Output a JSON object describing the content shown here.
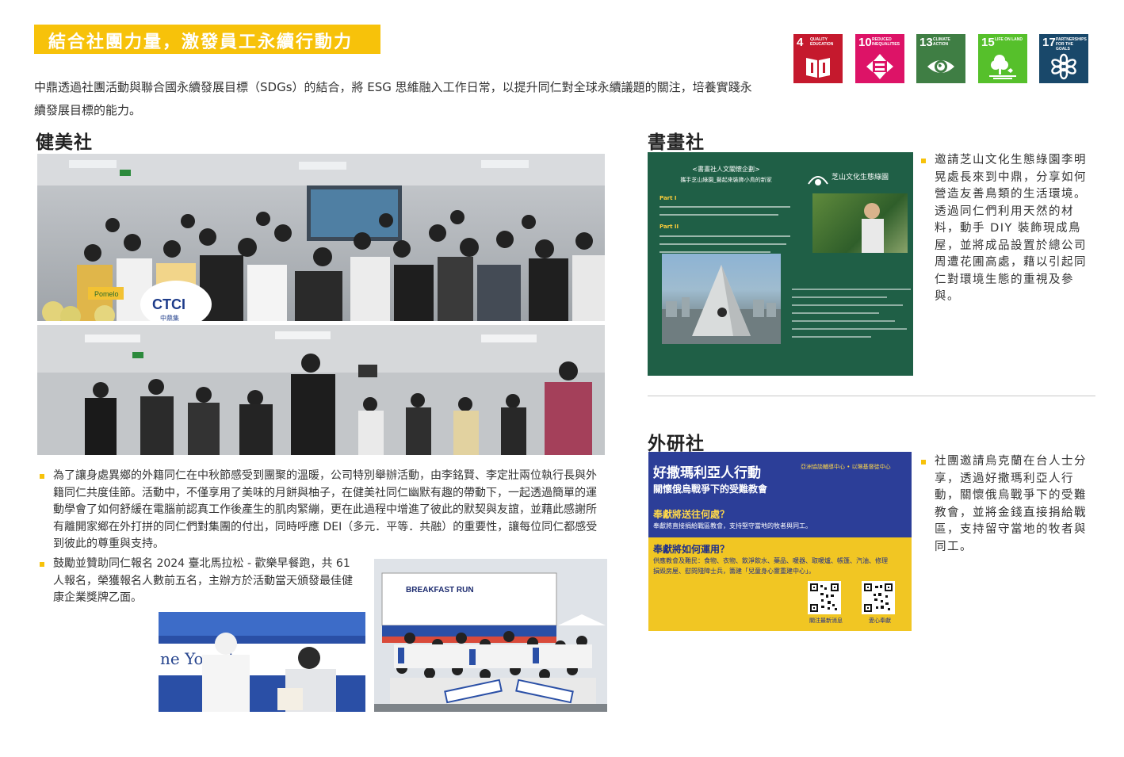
{
  "page": {
    "title": "結合社團力量，激發員工永續行動力",
    "intro": "中鼎透過社團活動與聯合國永續發展目標（SDGs）的結合，將 ESG 思維融入工作日常，以提升同仁對全球永續議題的關注，培養實踐永續發展目標的能力。",
    "accent_color": "#f7c20a"
  },
  "sdgs": [
    {
      "number": "4",
      "label": "QUALITY EDUCATION",
      "color": "#c5192d",
      "icon": "book-icon"
    },
    {
      "number": "10",
      "label": "REDUCED INEQUALITIES",
      "color": "#dd1367",
      "icon": "equality-icon"
    },
    {
      "number": "13",
      "label": "CLIMATE ACTION",
      "color": "#3f7e44",
      "icon": "eye-globe-icon"
    },
    {
      "number": "15",
      "label": "LIFE ON LAND",
      "color": "#56c02b",
      "icon": "tree-icon"
    },
    {
      "number": "17",
      "label": "PARTNERSHIPS FOR THE GOALS",
      "color": "#19486a",
      "icon": "rings-icon"
    }
  ],
  "fitness_club": {
    "heading": "健美社",
    "photo_sign_1": "CTCI",
    "photo_sign_2": "中鼎集",
    "photo_tag": "Pomelo",
    "bullets": [
      "為了讓身處異鄉的外籍同仁在中秋節感受到團聚的溫暖，公司特別舉辦活動，由李銘賢、李定壯兩位執行長與外籍同仁共度佳節。活動中，不僅享用了美味的月餅與柚子，在健美社同仁幽默有趣的帶動下，一起透過簡單的運動學會了如何舒緩在電腦前認真工作後產生的肌肉緊繃，更在此過程中增進了彼此的默契與友誼，並藉此感謝所有離開家鄉在外打拼的同仁們對集團的付出，同時呼應 DEI（多元．平等．共融）的重要性，讓每位同仁都感受到彼此的尊重與支持。",
      "鼓勵並贊助同仁報名 2024 臺北馬拉松 - 歡樂早餐跑，共 61 人報名，榮獲報名人數前五名，主辦方於活動當天頒發最佳健康企業獎牌乙面。"
    ],
    "photo_banner_text": "ne Yo   mits",
    "marathon_banner": "BREAKFAST RUN"
  },
  "art_club": {
    "heading": "書畫社",
    "poster": {
      "title": "<書畫社人文關懷企劃>",
      "subtitle": "攜手芝山綠園_藝起來裝飾小鳥的新家",
      "part1": "Part I",
      "part2": "Part II",
      "logo_text": "芝山文化生態綠園"
    },
    "bullet": "邀請芝山文化生態綠園李明晃處長來到中鼎，分享如何營造友善鳥類的生活環境。透過同仁們利用天然的材料，動手 DIY 裝飾現成鳥屋，並將成品設置於總公司周遭花圃高處，藉以引起同仁對環境生態的重視及參與。"
  },
  "research_club": {
    "heading": "外研社",
    "poster": {
      "title": "好撒瑪利亞人行動",
      "subtitle": "關懷俄烏戰爭下的受難教會",
      "org": "亞洲協談輔導中心 • 以琳基督徒中心",
      "q1": "奉獻將送往何處？",
      "a1": "奉獻將直接捐給戰區教會，支持堅守當地的牧者與同工。",
      "q2": "奉獻將如何運用？",
      "a2": "供應教會及難民：食物、衣物、飲淨飲水、藥品、暖器、取暖爐、帳篷、汽油、修理損毀房屋、慰問殘障士兵，籌建「兒童身心靈重建中心」。",
      "qr1_label": "關注最新消息",
      "qr2_label": "愛心奉獻"
    },
    "bullet": "社團邀請烏克蘭在台人士分享，透過好撒瑪利亞人行動，關懷俄烏戰爭下的受難教會，並將金錢直接捐給戰區，支持留守當地的牧者與同工。"
  }
}
